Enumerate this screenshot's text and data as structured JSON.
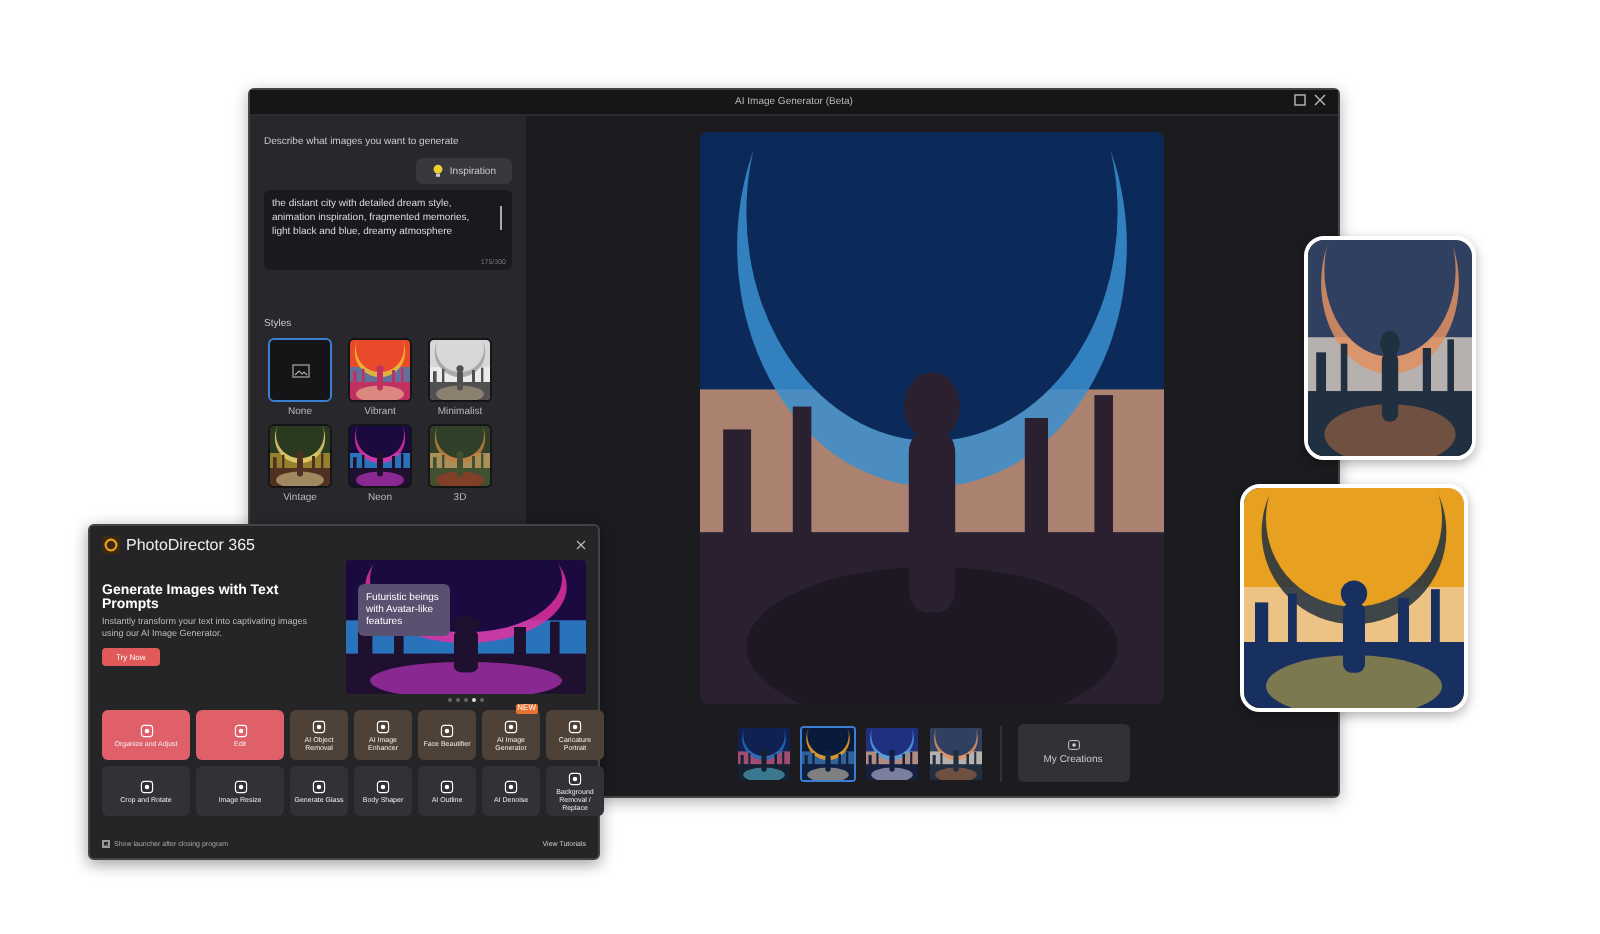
{
  "main_window": {
    "title": "AI Image Generator (Beta)",
    "prompt_label": "Describe what images you want to generate",
    "inspiration_button": "Inspiration",
    "prompt_text": "the distant city with detailed dream style, animation inspiration, fragmented memories, light black and blue, dreamy atmosphere",
    "char_count": "175/300",
    "styles_label": "Styles",
    "styles": [
      {
        "label": "None",
        "kind": "none",
        "selected": true
      },
      {
        "label": "Vibrant",
        "kind": "picture",
        "selected": false
      },
      {
        "label": "Minimalist",
        "kind": "picture",
        "selected": false
      },
      {
        "label": "Vintage",
        "kind": "picture",
        "selected": false
      },
      {
        "label": "Neon",
        "kind": "picture",
        "selected": false
      },
      {
        "label": "3D",
        "kind": "picture",
        "selected": false
      }
    ],
    "results": [
      {
        "kind": "picture",
        "selected": false
      },
      {
        "kind": "picture",
        "selected": true
      },
      {
        "kind": "picture",
        "selected": false
      },
      {
        "kind": "picture",
        "selected": false
      }
    ],
    "my_creations_button": "My Creations"
  },
  "launcher": {
    "app_name": "PhotoDirector 365",
    "headline": "Generate Images with Text Prompts",
    "description": "Instantly transform your text into captivating images using our AI Image Generator.",
    "try_button": "Try Now",
    "banner_caption": "Futuristic beings with Avatar-like features",
    "carousel": [
      {
        "selected": false
      },
      {
        "selected": false
      },
      {
        "selected": false
      },
      {
        "selected": true
      },
      {
        "selected": false
      }
    ],
    "tools": [
      {
        "label": "Organize and Adjust",
        "kind": "primary"
      },
      {
        "label": "Edit",
        "kind": "primary"
      },
      {
        "label": "AI Object Removal",
        "kind": "feature"
      },
      {
        "label": "AI Image Enhancer",
        "kind": "feature"
      },
      {
        "label": "Face Beautifier",
        "kind": "feature"
      },
      {
        "label": "AI Image Generator",
        "kind": "feature",
        "badge": "NEW"
      },
      {
        "label": "Caricature Portrait",
        "kind": "feature"
      },
      {
        "label": "Crop and Rotate",
        "kind": "tool"
      },
      {
        "label": "Image Resize",
        "kind": "tool"
      },
      {
        "label": "Generate Glass",
        "kind": "tool"
      },
      {
        "label": "Body Shaper",
        "kind": "tool"
      },
      {
        "label": "AI Outline",
        "kind": "tool"
      },
      {
        "label": "AI Denoise",
        "kind": "tool"
      },
      {
        "label": "Background Removal / Replace",
        "kind": "tool"
      }
    ],
    "show_launcher": {
      "label": "Show launcher after closing program",
      "checked": true
    },
    "tutorials_link": "View Tutorials"
  },
  "showcase": [
    {
      "kind": "picture"
    },
    {
      "kind": "picture"
    }
  ]
}
